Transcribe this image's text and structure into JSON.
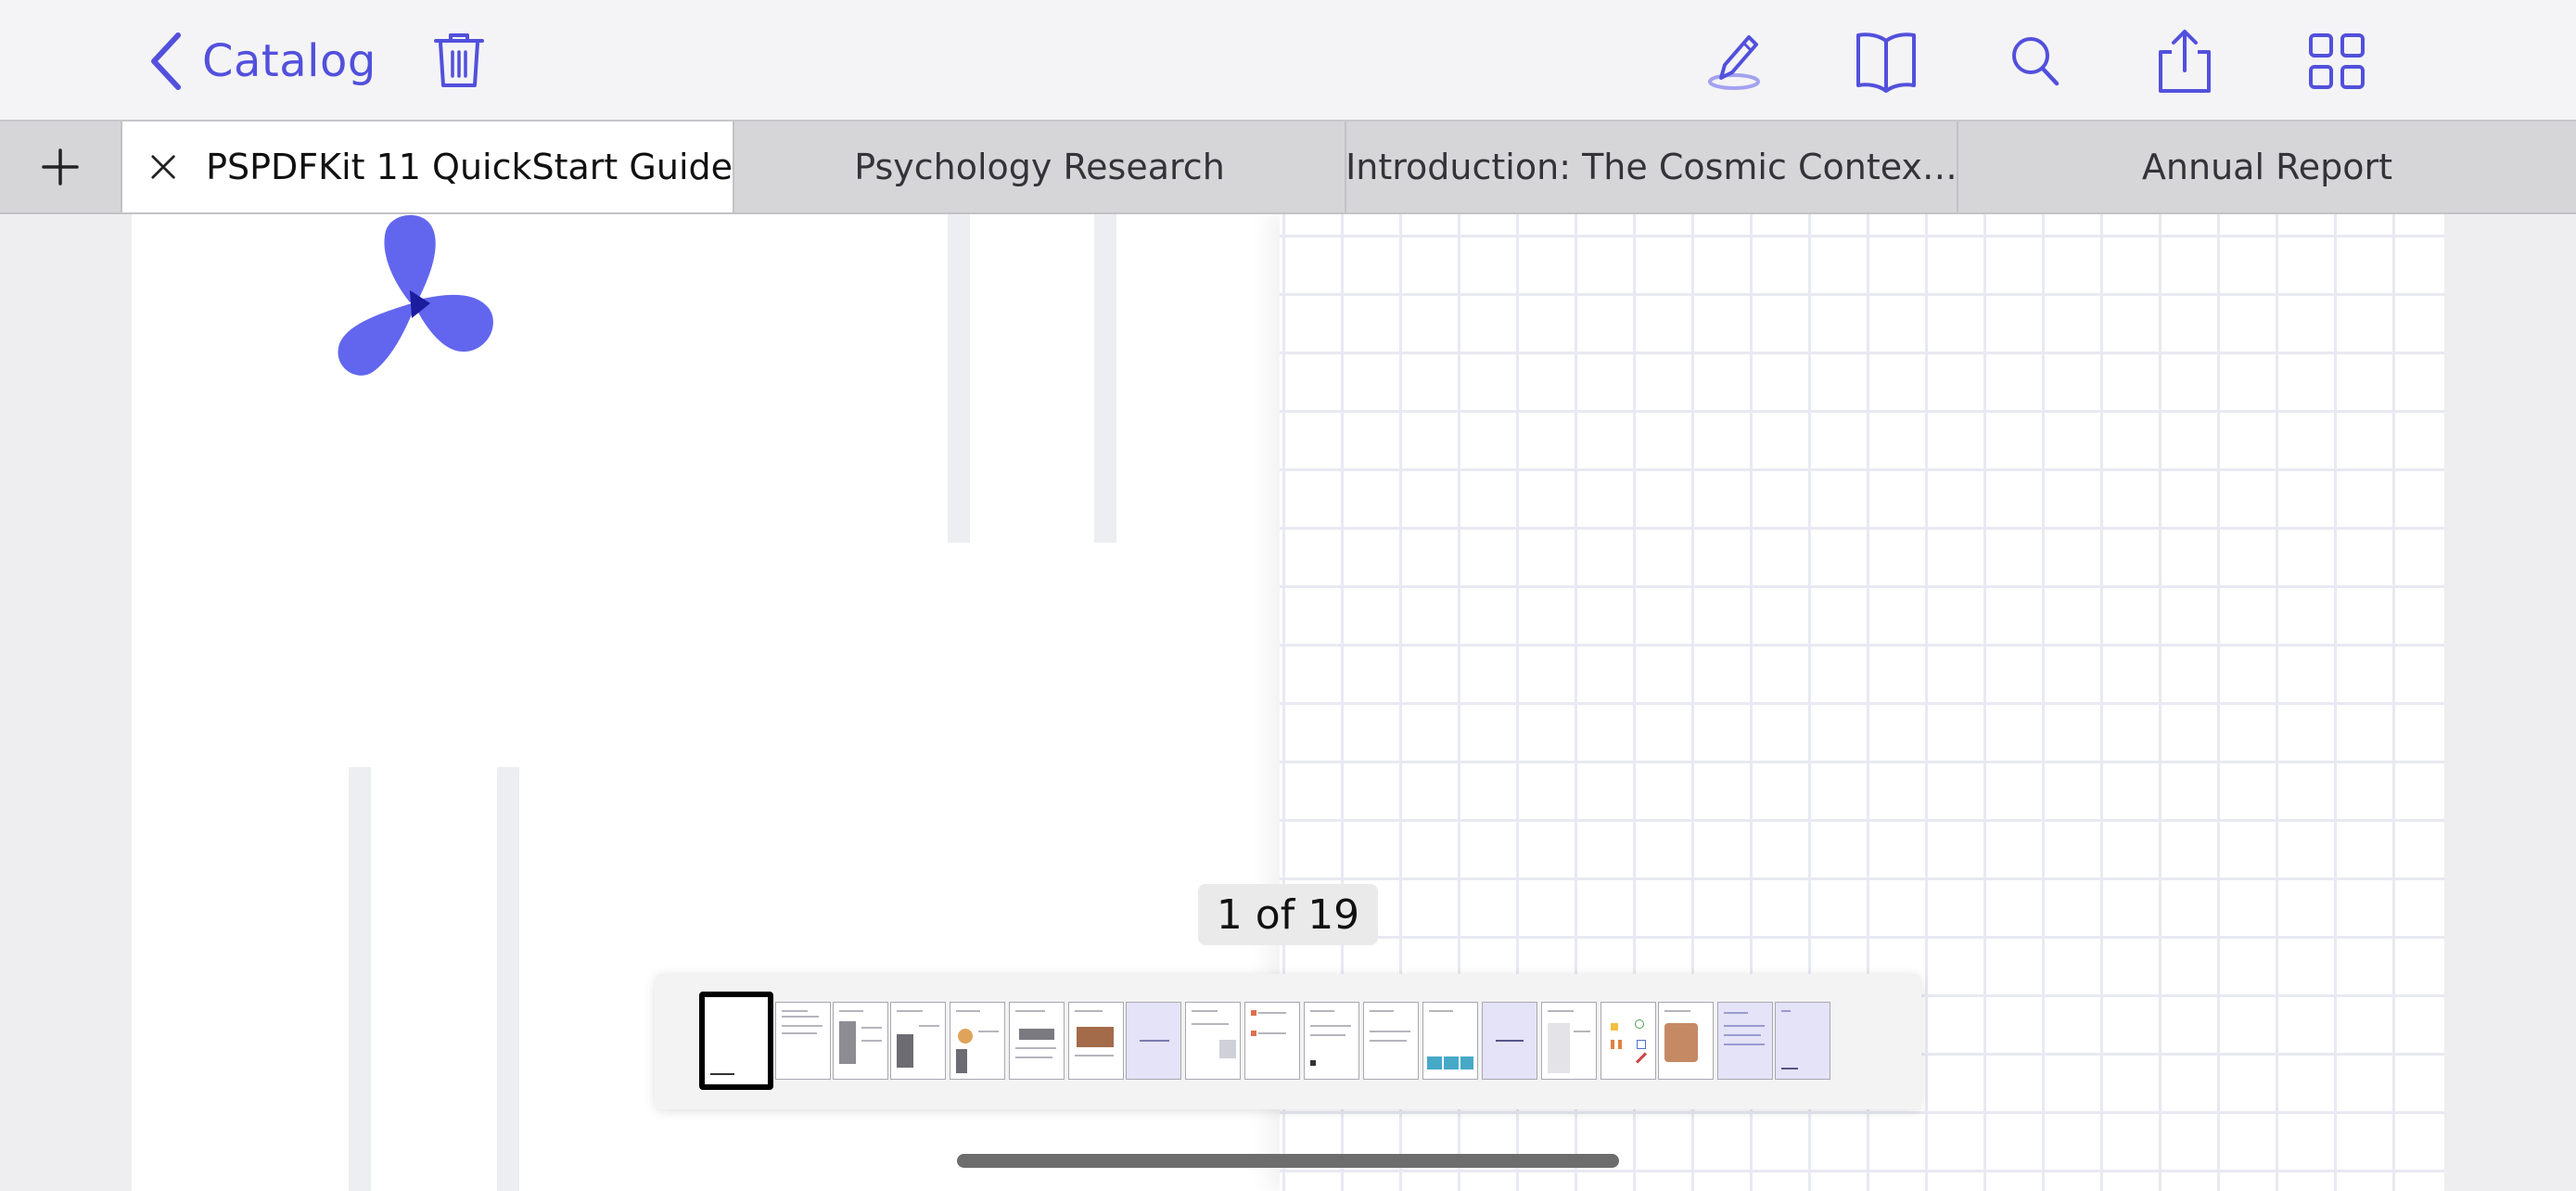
{
  "toolbar": {
    "back_label": "Catalog",
    "icons": [
      "chevron-left-icon",
      "trash-icon",
      "annotation-pen-icon",
      "outline-book-icon",
      "search-icon",
      "share-icon",
      "thumbnail-grid-icon"
    ],
    "accent_color": "#5250dc"
  },
  "tabs": {
    "add_icon": "plus-icon",
    "items": [
      {
        "label": "PSPDFKit 11 QuickStart Guide",
        "active": true
      },
      {
        "label": "Psychology Research",
        "active": false
      },
      {
        "label": "Introduction: The Cosmic Contex…",
        "active": false
      },
      {
        "label": "Annual Report",
        "active": false
      }
    ]
  },
  "document": {
    "logo_icon": "pspdfkit-logo-icon",
    "logo_color": "#6266ee"
  },
  "pager": {
    "label": "1 of 19",
    "current_page": 1,
    "total_pages": 19
  }
}
